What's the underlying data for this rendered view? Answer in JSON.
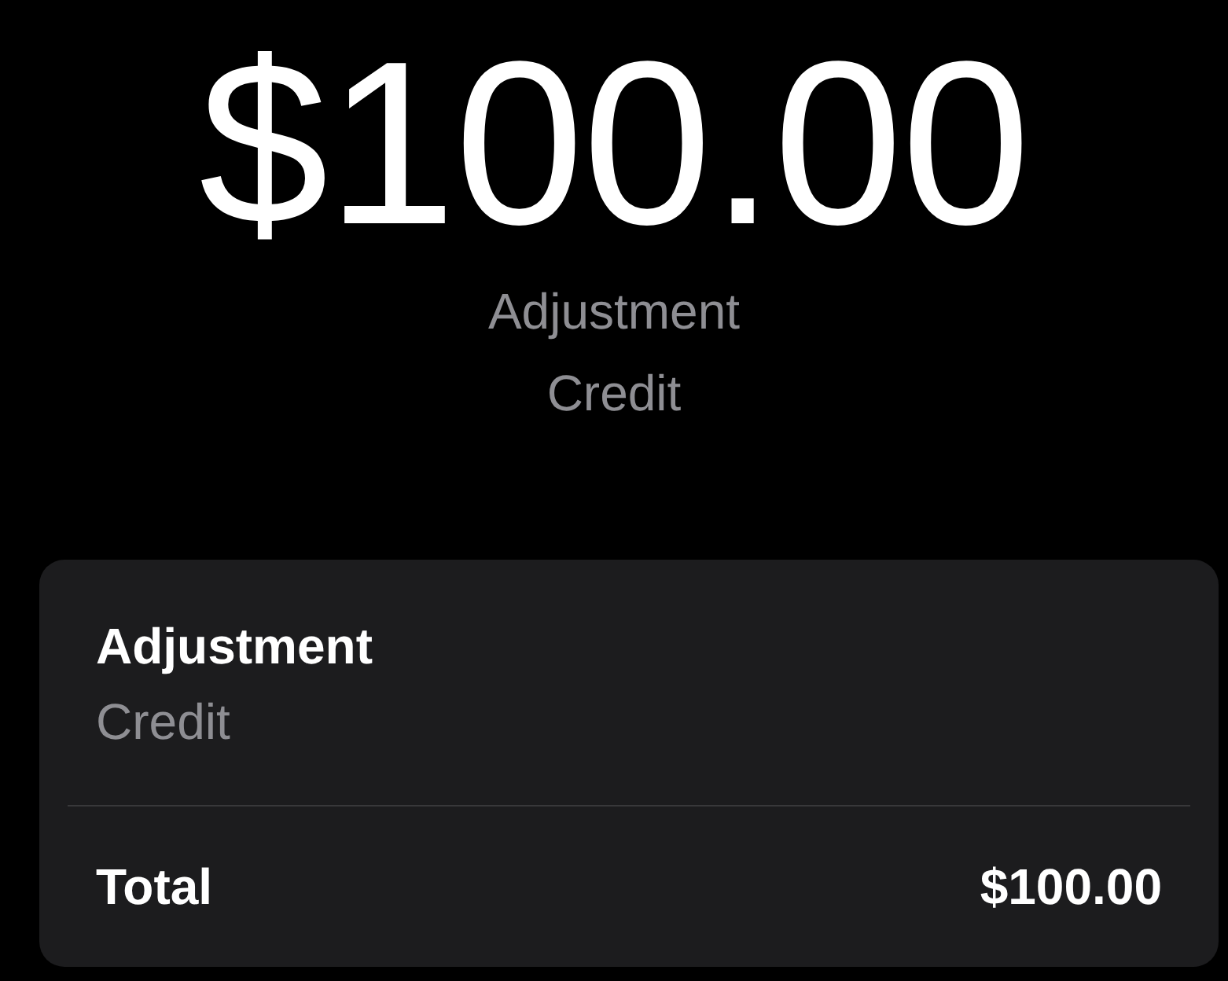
{
  "header": {
    "amount": "$100.00",
    "title": "Adjustment",
    "subtitle": "Credit"
  },
  "card": {
    "item": {
      "title": "Adjustment",
      "subtitle": "Credit"
    },
    "total": {
      "label": "Total",
      "value": "$100.00"
    }
  }
}
